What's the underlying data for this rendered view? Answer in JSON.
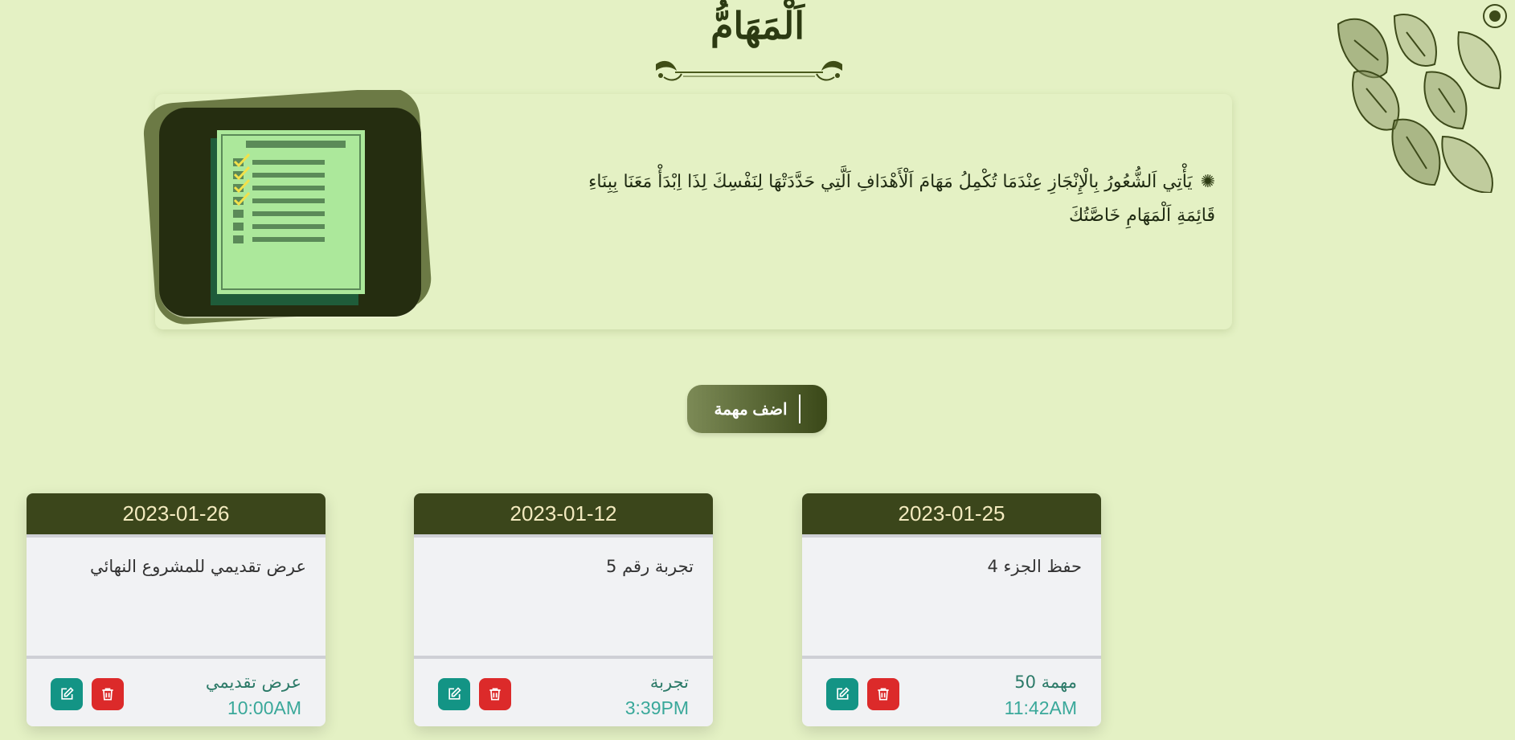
{
  "header": {
    "title": "اَلْمَهَامُّ"
  },
  "intro": {
    "text": "يَأْتِي اَلشُّعُورُ بِالْإِنْجَازِ عِنْدَمَا تُكْمِلُ مَهَامَ اَلْأَهْدَافِ اَلَّتِي حَدَّدَتْهَا لِنَفْسِكَ لِذَا اِبْدَأْ مَعَنَا بِبِنَاءِ قَائِمَةِ اَلْمَهَامِ خَاصَّتُكَ",
    "bullet_icon": "sparkle-icon"
  },
  "actions": {
    "add_task_label": "اضف مهمة"
  },
  "cards": [
    {
      "date": "2023-01-25",
      "title": "حفظ الجزء 4",
      "category": "مهمة 50",
      "time": "11:42AM"
    },
    {
      "date": "2023-01-12",
      "title": "تجربة رقم 5",
      "category": "تجربة",
      "time": "3:39PM"
    },
    {
      "date": "2023-01-26",
      "title": "عرض تقديمي للمشروع النهائي",
      "category": "عرض تقديمي",
      "time": "10:00AM"
    }
  ],
  "icons": {
    "edit": "edit-icon",
    "delete": "trash-icon"
  },
  "colors": {
    "background": "#e4f1c4",
    "card_header": "#3b461b",
    "edit_button": "#139485",
    "delete_button": "#dc2a2a",
    "time_text": "#3aa89a"
  }
}
